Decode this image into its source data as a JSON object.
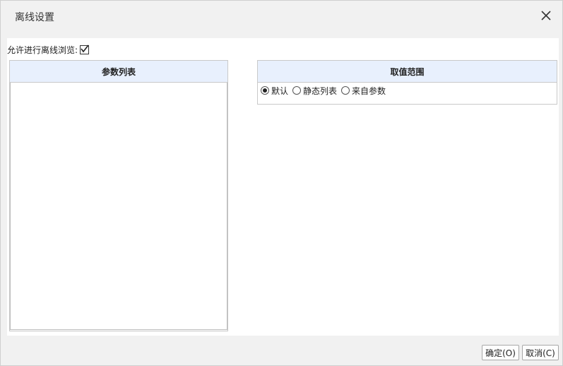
{
  "dialog": {
    "title": "离线设置",
    "close_icon": "close-icon"
  },
  "settings": {
    "allow_offline_label": "允许进行离线浏览:",
    "allow_offline_checked": true
  },
  "param_list": {
    "header": "参数列表",
    "items": []
  },
  "value_range": {
    "header": "取值范围",
    "options": [
      {
        "label": "默认",
        "checked": true
      },
      {
        "label": "静态列表",
        "checked": false
      },
      {
        "label": "来自参数",
        "checked": false
      }
    ]
  },
  "footer": {
    "ok_label": "确定(O)",
    "cancel_label": "取消(C)"
  }
}
